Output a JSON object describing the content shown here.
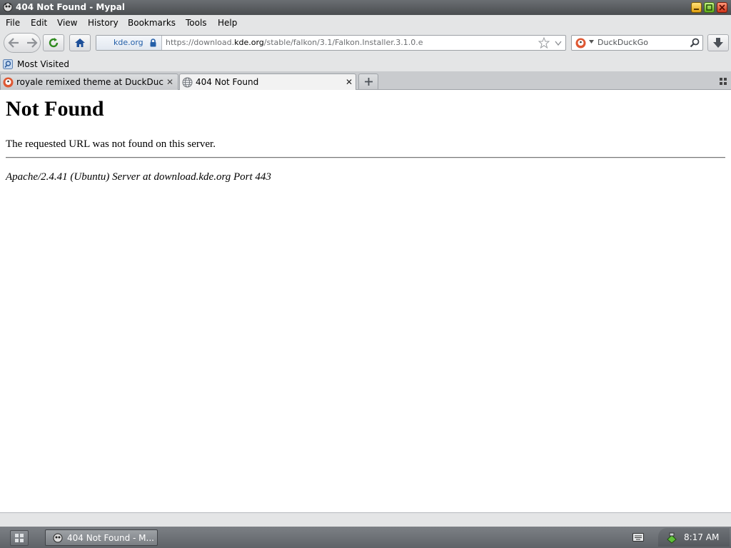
{
  "window": {
    "title": "404 Not Found - Mypal"
  },
  "menubar": {
    "items": [
      {
        "label": "File"
      },
      {
        "label": "Edit"
      },
      {
        "label": "View"
      },
      {
        "label": "History"
      },
      {
        "label": "Bookmarks"
      },
      {
        "label": "Tools"
      },
      {
        "label": "Help"
      }
    ]
  },
  "navbar": {
    "identity_domain": "kde.org",
    "url_prefix": "https://download.",
    "url_host": "kde.org",
    "url_path": "/stable/falkon/3.1/Falkon.Installer.3.1.0.e",
    "search_placeholder": "DuckDuckGo"
  },
  "bookmarks": {
    "items": [
      {
        "label": "Most Visited"
      }
    ]
  },
  "tabs": [
    {
      "label": "royale remixed theme at DuckDuc…",
      "active": false
    },
    {
      "label": "404 Not Found",
      "active": true
    }
  ],
  "page": {
    "heading": "Not Found",
    "message": "The requested URL was not found on this server.",
    "server_signature": "Apache/2.4.41 (Ubuntu) Server at download.kde.org Port 443"
  },
  "taskbar": {
    "window_label": "404 Not Found - M...",
    "clock": "8:17 AM"
  },
  "colors": {
    "link_blue": "#245fa8",
    "min": "#e2a20f",
    "max": "#5fae18",
    "close": "#d0341a"
  }
}
